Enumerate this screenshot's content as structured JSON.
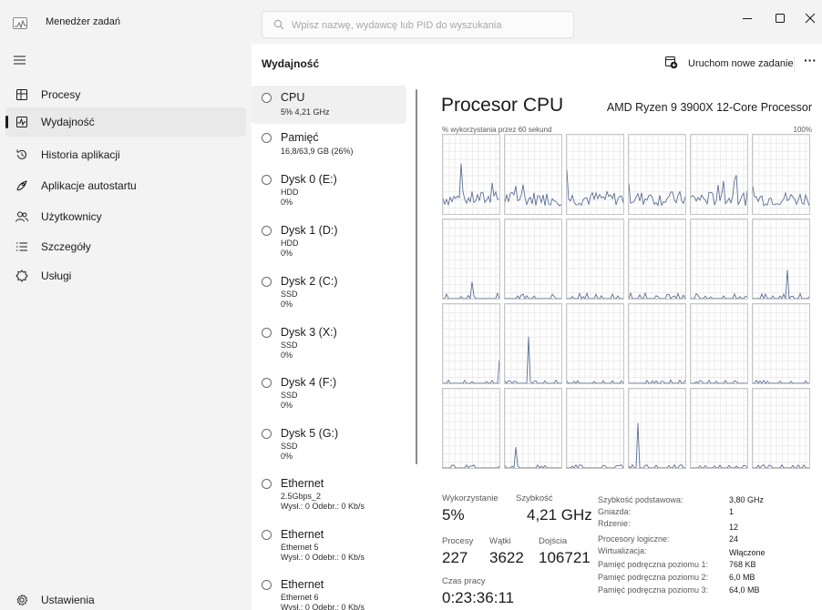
{
  "window": {
    "title": "Menedżer zadań"
  },
  "search": {
    "placeholder": "Wpisz nazwę, wydawcę lub PID do wyszukania"
  },
  "nav": {
    "items": [
      {
        "label": "Procesy",
        "icon": "processes-icon"
      },
      {
        "label": "Wydajność",
        "icon": "performance-icon"
      },
      {
        "label": "Historia aplikacji",
        "icon": "app-history-icon"
      },
      {
        "label": "Aplikacje autostartu",
        "icon": "startup-apps-icon"
      },
      {
        "label": "Użytkownicy",
        "icon": "users-icon"
      },
      {
        "label": "Szczegóły",
        "icon": "details-icon"
      },
      {
        "label": "Usługi",
        "icon": "services-icon"
      }
    ],
    "active_index": 1,
    "settings_label": "Ustawienia"
  },
  "header": {
    "title": "Wydajność",
    "run_task_label": "Uruchom nowe zadanie",
    "more_label": "···"
  },
  "devices": [
    {
      "name": "CPU",
      "lines": [
        "5% 4,21 GHz"
      ]
    },
    {
      "name": "Pamięć",
      "lines": [
        "16,8/63,9 GB (26%)"
      ]
    },
    {
      "name": "Dysk 0 (E:)",
      "lines": [
        "HDD",
        "0%"
      ]
    },
    {
      "name": "Dysk 1 (D:)",
      "lines": [
        "HDD",
        "0%"
      ]
    },
    {
      "name": "Dysk 2 (C:)",
      "lines": [
        "SSD",
        "0%"
      ]
    },
    {
      "name": "Dysk 3 (X:)",
      "lines": [
        "SSD",
        "0%"
      ]
    },
    {
      "name": "Dysk 4 (F:)",
      "lines": [
        "SSD",
        "0%"
      ]
    },
    {
      "name": "Dysk 5 (G:)",
      "lines": [
        "SSD",
        "0%"
      ]
    },
    {
      "name": "Ethernet",
      "lines": [
        "2.5Gbps_2",
        "Wysł.: 0 Odebr.: 0 Kb/s"
      ]
    },
    {
      "name": "Ethernet",
      "lines": [
        "Ethernet 5",
        "Wysł.: 0 Odebr.: 0 Kb/s"
      ]
    },
    {
      "name": "Ethernet",
      "lines": [
        "Ethernet 6",
        "Wysł.: 0 Odebr.: 0 Kb/s"
      ]
    }
  ],
  "cpu": {
    "title": "Procesor CPU",
    "model": "AMD Ryzen 9 3900X 12-Core Processor",
    "graph_label": "% wykorzystania przez 60 sekund",
    "graph_max": "100%",
    "logical_processor_graphs": 24,
    "line_color": "#5b6f96",
    "stats": {
      "utilization_label": "Wykorzystanie",
      "utilization": "5%",
      "speed_label": "Szybkość",
      "speed": "4,21 GHz",
      "processes_label": "Procesy",
      "processes": "227",
      "threads_label": "Wątki",
      "threads": "3622",
      "handles_label": "Dojścia",
      "handles": "106721",
      "uptime_label": "Czas pracy",
      "uptime": "0:23:36:11"
    },
    "specs": [
      {
        "key": "Szybkość podstawowa:",
        "value": "3,80 GHz"
      },
      {
        "key": "Gniazda:",
        "value": "1"
      },
      {
        "key": "Rdzenie:",
        "value": "12"
      },
      {
        "key": "Procesory logiczne:",
        "value": "24"
      },
      {
        "key": "Wirtualizacja:",
        "value": "Włączone"
      },
      {
        "key": "Pamięć podręczna poziomu 1:",
        "value": "768 KB"
      },
      {
        "key": "Pamięć podręczna poziomu 2:",
        "value": "6,0 MB"
      },
      {
        "key": "Pamięć podręczna poziomu 3:",
        "value": "64,0 MB"
      }
    ]
  }
}
